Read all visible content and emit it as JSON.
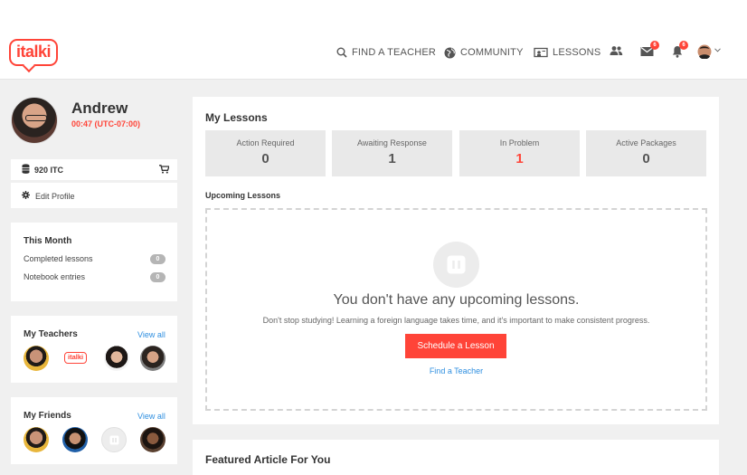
{
  "brand": {
    "logo_text": "italki",
    "accent": "#ff4438",
    "link_color": "#2f8fe0"
  },
  "nav": {
    "find_teacher": "FIND A TEACHER",
    "community": "COMMUNITY",
    "lessons": "LESSONS",
    "messages_badge": "6",
    "notifications_badge": "6",
    "icons": [
      "search-icon",
      "globe-icon",
      "lessons-icon",
      "people-icon",
      "mail-icon",
      "bell-icon",
      "user-avatar",
      "chevron-down-icon"
    ]
  },
  "profile": {
    "name": "Andrew",
    "time": "00:47 (UTC-07:00)",
    "credits": "920 ITC",
    "edit_profile": "Edit Profile"
  },
  "this_month": {
    "title": "This Month",
    "rows": [
      {
        "label": "Completed lessons",
        "count": "0"
      },
      {
        "label": "Notebook entries",
        "count": "0"
      }
    ]
  },
  "my_teachers": {
    "title": "My Teachers",
    "view_all": "View all",
    "mini_logo": "italki"
  },
  "my_friends": {
    "title": "My Friends",
    "view_all": "View all"
  },
  "my_lessons": {
    "title": "My Lessons",
    "stats": [
      {
        "label": "Action Required",
        "value": "0"
      },
      {
        "label": "Awaiting Response",
        "value": "1"
      },
      {
        "label": "In Problem",
        "value": "1"
      },
      {
        "label": "Active Packages",
        "value": "0"
      }
    ],
    "upcoming_title": "Upcoming Lessons",
    "empty_title": "You don't have any upcoming lessons.",
    "empty_sub": "Don't stop studying! Learning a foreign language takes time, and it's important to make consistent progress.",
    "schedule_button": "Schedule a Lesson",
    "find_teacher_link": "Find a Teacher"
  },
  "featured": {
    "title": "Featured Article For You"
  }
}
